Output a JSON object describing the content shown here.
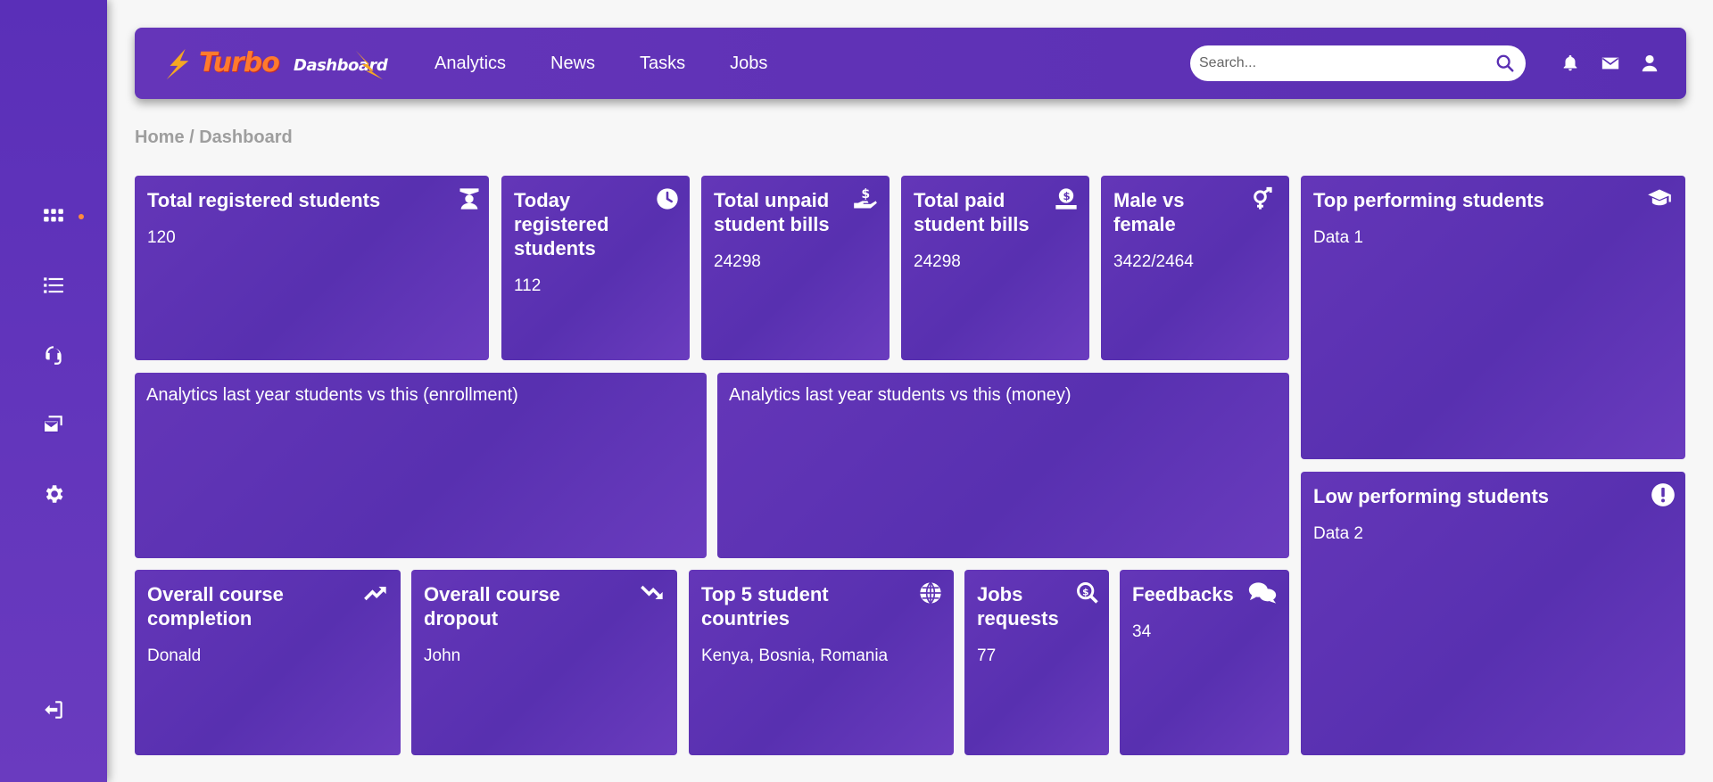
{
  "sidebar": {
    "items": [
      {
        "icon": "grid-icon"
      },
      {
        "icon": "list-icon"
      },
      {
        "icon": "headset-icon"
      },
      {
        "icon": "mail-cards-icon"
      },
      {
        "icon": "gear-icon"
      },
      {
        "icon": "logout-icon"
      }
    ],
    "accent_dot_color": "#ff8a3d"
  },
  "header": {
    "logo": {
      "part1": "Turbo",
      "part2": "Dashboard"
    },
    "nav": [
      "Analytics",
      "News",
      "Tasks",
      "Jobs"
    ],
    "search": {
      "placeholder": "Search...",
      "value": ""
    },
    "icons": [
      "bell-icon",
      "envelope-icon",
      "user-icon"
    ]
  },
  "breadcrumb": "Home / Dashboard",
  "stats": {
    "total_registered": {
      "title": "Total registered students",
      "value": "120",
      "icon": "graduate-icon"
    },
    "today_registered": {
      "title": "Today registered students",
      "value": "112",
      "icon": "clock-icon"
    },
    "total_unpaid": {
      "title": "Total unpaid student bills",
      "value": "24298",
      "icon": "hand-dollar-icon"
    },
    "total_paid": {
      "title": "Total paid student bills",
      "value": "24298",
      "icon": "coin-hand-icon"
    },
    "male_female": {
      "title": "Male vs female",
      "value": "3422/2464",
      "icon": "gender-icon"
    },
    "top_performing": {
      "title": "Top performing students",
      "value": "Data 1",
      "icon": "graduation-cap-icon"
    },
    "low_performing": {
      "title": "Low performing students",
      "value": "Data 2",
      "icon": "exclamation-icon"
    }
  },
  "analytics": {
    "enrollment": "Analytics last year students vs this (enrollment)",
    "money": "Analytics last year students vs this (money)"
  },
  "bottom": {
    "completion": {
      "title": "Overall course completion",
      "value": "Donald",
      "icon": "trend-up-icon"
    },
    "dropout": {
      "title": "Overall course dropout",
      "value": "John",
      "icon": "trend-down-icon"
    },
    "countries": {
      "title": "Top 5 student countries",
      "value": "Kenya, Bosnia, Romania",
      "icon": "globe-icon"
    },
    "jobs": {
      "title": "Jobs requests",
      "value": "77",
      "icon": "search-dollar-icon"
    },
    "feedbacks": {
      "title": "Feedbacks",
      "value": "34",
      "icon": "chat-icon"
    }
  },
  "colors": {
    "card": "#5d32b3",
    "sidebar": "#5a2fb8",
    "background": "#f7f7f7",
    "breadcrumb": "#9e9e9e"
  }
}
